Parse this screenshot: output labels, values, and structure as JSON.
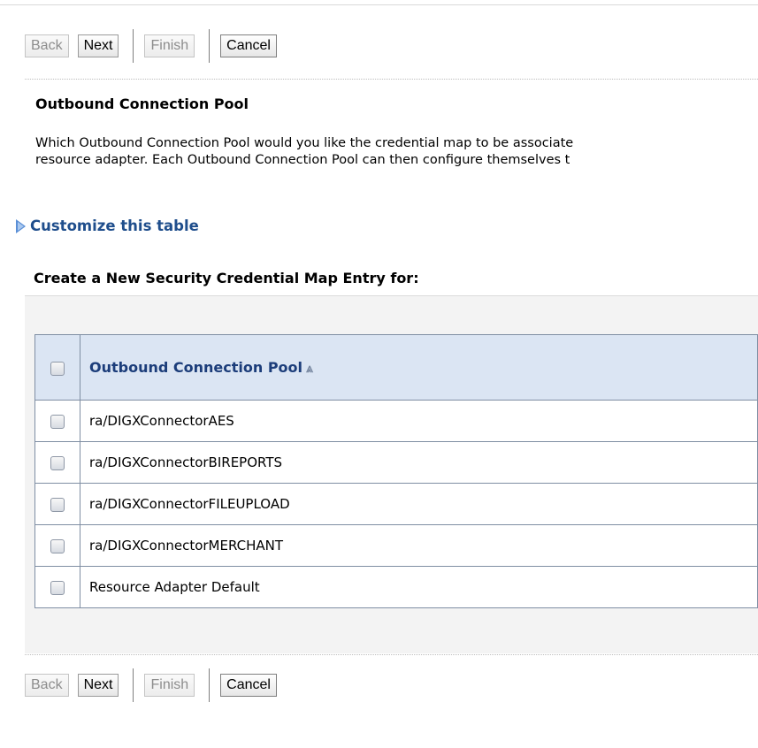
{
  "toolbar": {
    "back_label": "Back",
    "next_label": "Next",
    "finish_label": "Finish",
    "cancel_label": "Cancel"
  },
  "section": {
    "title": "Outbound Connection Pool",
    "description_line1": "Which Outbound Connection Pool would you like the credential map to be associate",
    "description_line2": "resource adapter. Each Outbound Connection Pool can then configure themselves t"
  },
  "customize": {
    "label": "Customize this table",
    "icon": "expand-triangle-icon"
  },
  "table": {
    "title": "Create a New Security Credential Map Entry for:",
    "column_header": "Outbound Connection Pool",
    "sort_icon": "sort-ascending-icon",
    "rows": [
      {
        "name": "ra/DIGXConnectorAES"
      },
      {
        "name": "ra/DIGXConnectorBIREPORTS"
      },
      {
        "name": "ra/DIGXConnectorFILEUPLOAD"
      },
      {
        "name": "ra/DIGXConnectorMERCHANT"
      },
      {
        "name": "Resource Adapter Default"
      }
    ]
  },
  "colors": {
    "link": "#1f4e8c",
    "header_bg": "#dbe5f3",
    "panel_bg": "#f3f3f3"
  }
}
